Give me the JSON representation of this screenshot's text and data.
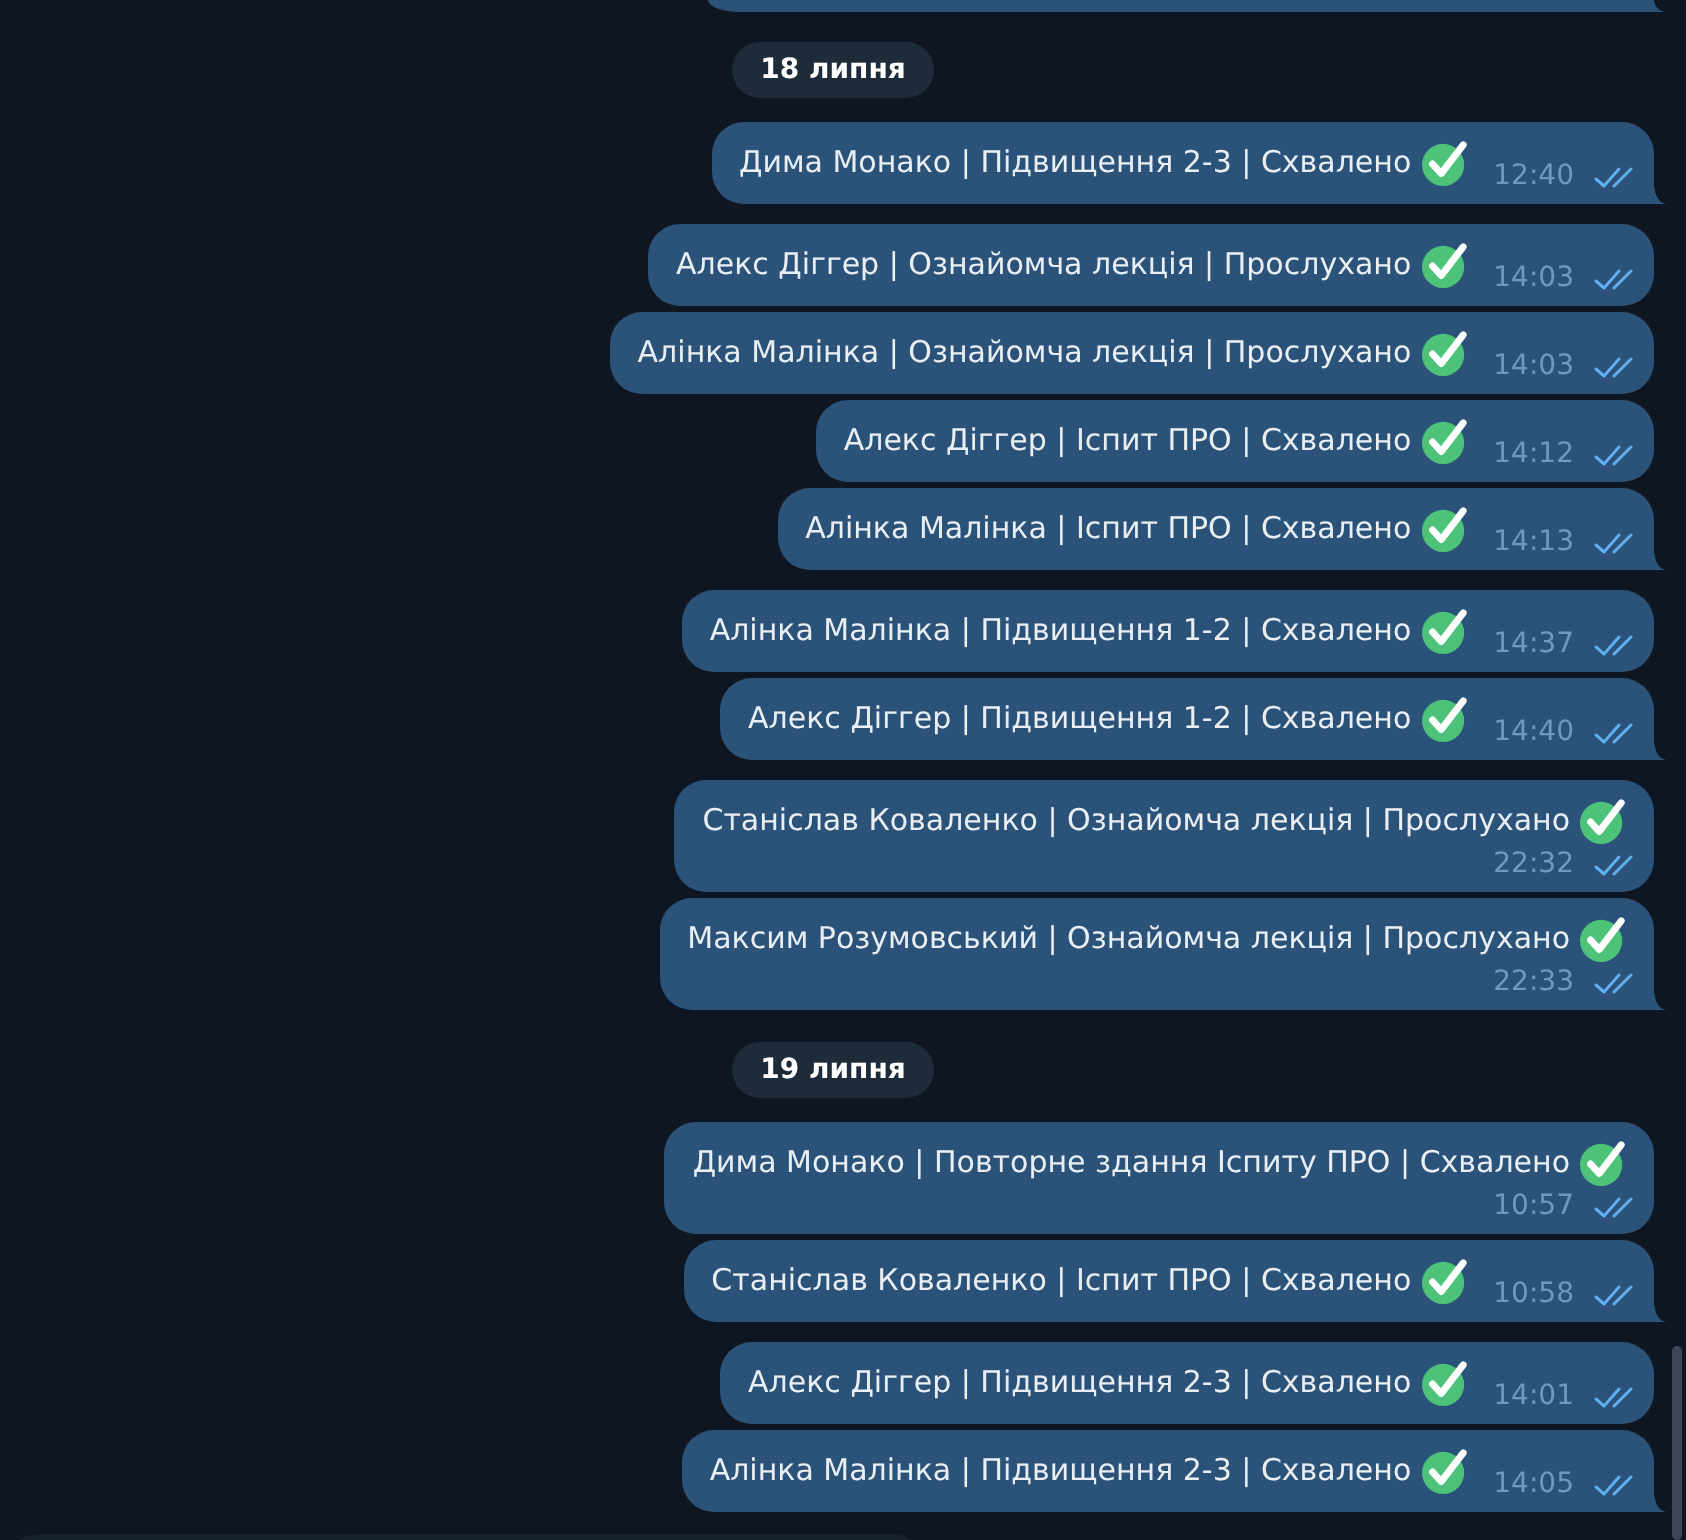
{
  "cut_off_message_above": true,
  "days": [
    {
      "date": "18 липня",
      "groups": [
        {
          "messages": [
            {
              "text": "Дима Монако | Підвищення 2-3 | Схвалено",
              "check_emoji": true,
              "time": "12:40",
              "read": true
            }
          ]
        },
        {
          "messages": [
            {
              "text": "Алекс Діггер | Ознайомча лекція | Прослухано",
              "check_emoji": true,
              "time": "14:03",
              "read": true
            },
            {
              "text": "Алінка Малінка | Ознайомча лекція | Прослухано",
              "check_emoji": true,
              "time": "14:03",
              "read": true
            },
            {
              "text": "Алекс Діггер | Іспит ПРО | Схвалено",
              "check_emoji": true,
              "time": "14:12",
              "read": true
            },
            {
              "text": "Алінка Малінка | Іспит ПРО | Схвалено",
              "check_emoji": true,
              "time": "14:13",
              "read": true
            }
          ]
        },
        {
          "messages": [
            {
              "text": "Алінка Малінка | Підвищення 1-2 | Схвалено",
              "check_emoji": true,
              "time": "14:37",
              "read": true
            },
            {
              "text": "Алекс Діггер | Підвищення 1-2 | Схвалено",
              "check_emoji": true,
              "time": "14:40",
              "read": true
            }
          ]
        },
        {
          "messages": [
            {
              "text": "Станіслав Коваленко | Ознайомча лекція | Прослухано",
              "check_emoji": true,
              "time": "22:32",
              "read": true
            },
            {
              "text": "Максим Розумовський | Ознайомча лекція | Прослухано",
              "check_emoji": true,
              "time": "22:33",
              "read": true
            }
          ]
        }
      ]
    },
    {
      "date": "19 липня",
      "groups": [
        {
          "messages": [
            {
              "text": "Дима Монако | Повторне здання Іспиту ПРО | Схвалено",
              "check_emoji": true,
              "time": "10:57",
              "read": true
            },
            {
              "text": "Станіслав Коваленко | Іспит ПРО | Схвалено",
              "check_emoji": true,
              "time": "10:58",
              "read": true
            }
          ]
        },
        {
          "messages": [
            {
              "text": "Алекс Діггер | Підвищення 2-3 | Схвалено",
              "check_emoji": true,
              "time": "14:01",
              "read": true
            },
            {
              "text": "Алінка Малінка | Підвищення 2-3 | Схвалено",
              "check_emoji": true,
              "time": "14:05",
              "read": true
            }
          ]
        }
      ]
    }
  ],
  "cut_off_panel_below": true
}
